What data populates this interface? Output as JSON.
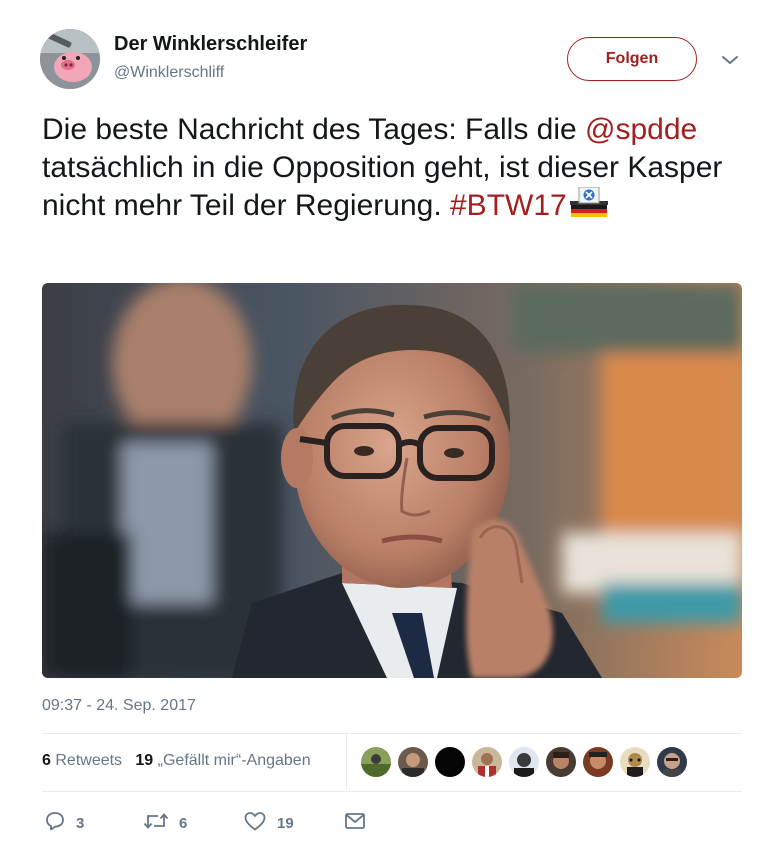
{
  "author": {
    "name": "Der Winklerschleifer",
    "handle": "@Winklerschliff",
    "follow_label": "Folgen"
  },
  "tweet": {
    "text_1": "Die beste Nachricht des Tages: Falls die ",
    "mention": "@spdde",
    "text_2": " tatsächlich in die Opposition geht, ist dieser Kasper nicht mehr Teil der Regierung. ",
    "hashtag": "#BTW17",
    "timestamp": "09:37 - 24. Sep. 2017"
  },
  "stats": {
    "retweets_count": "6",
    "retweets_label": "Retweets",
    "likes_count": "19",
    "likes_label": "„Gefällt mir“-Angaben"
  },
  "actions": {
    "reply_count": "3",
    "retweet_count": "6",
    "like_count": "19"
  },
  "icons": {
    "reply": "reply-icon",
    "retweet": "retweet-icon",
    "like": "heart-icon",
    "message": "envelope-icon",
    "caret": "chevron-down-icon"
  },
  "colors": {
    "accent": "#a31f1f",
    "text": "#14171a",
    "secondary": "#657786",
    "divider": "#e6ecf0"
  }
}
